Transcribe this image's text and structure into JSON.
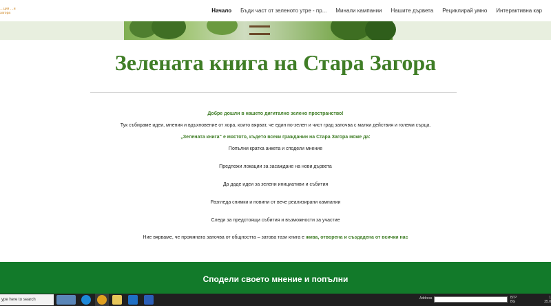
{
  "app": {
    "logo_text": "…ция\n…и загора"
  },
  "nav": {
    "items": [
      {
        "label": "Начало",
        "active": true
      },
      {
        "label": "Бъди част от зеленото утре - пр...",
        "active": false
      },
      {
        "label": "Минали кампании",
        "active": false
      },
      {
        "label": "Нашите дървета",
        "active": false
      },
      {
        "label": "Рециклирай умно",
        "active": false
      },
      {
        "label": "Интерактивна кар",
        "active": false
      }
    ]
  },
  "main": {
    "title": "Зелената книга на Стара Загора",
    "welcome": "Добре дошли в нашето дигитално зелено пространство!",
    "intro": "Тук събираме идеи, мнения и вдъхновение от хора, които вярват, че един по-зелен и чист град започва с малки действия и големи сърца.",
    "can_do": "„Зелената книга“ е мястото, където всеки гражданин на Стара Загора може да:",
    "list": [
      "Попълни кратка анкета и сподели мнение",
      "Предложи локации за засаждане на нови дървета",
      "Да даде идеи за зелени инициативи и събития",
      "Разгледа снимки и новини от вече реализирани кампании",
      "Следи за предстоящи събития и възможности за участие"
    ],
    "closing_prefix": "Ние вярваме, че промяната започва от общността – затова тази книга е ",
    "closing_highlight": "жива, отворена и създадена от всички нас"
  },
  "cta": {
    "title": "Сподели своето мнение и попълни"
  },
  "taskbar": {
    "search_placeholder": "ype here to search",
    "address_label": "Address",
    "tray_lang_1": "БГР",
    "tray_lang_2": "BG",
    "clock_time": "1",
    "clock_date": "25.0"
  },
  "colors": {
    "brand_green": "#3f7d26",
    "section_green": "#127a2a"
  }
}
